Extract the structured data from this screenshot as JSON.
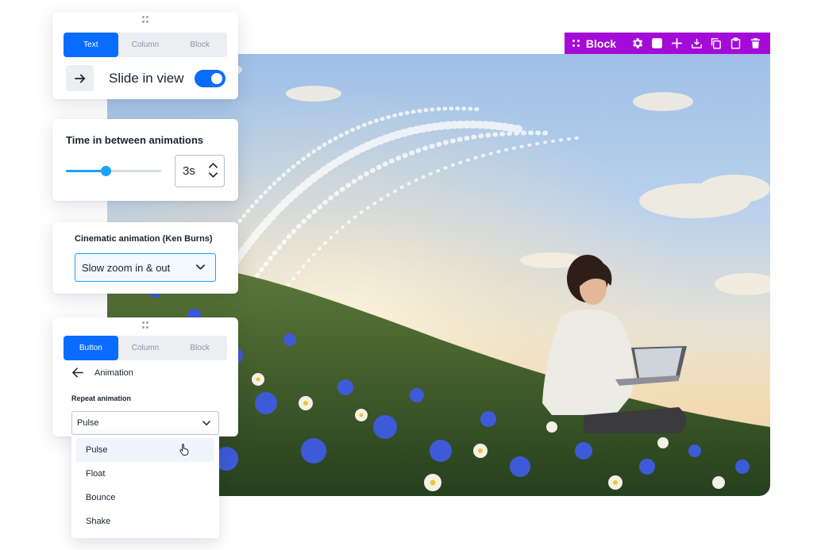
{
  "toolbar": {
    "label": "Block",
    "color": "#a40bd6",
    "actions": [
      "settings-icon",
      "color-swatch",
      "add-icon",
      "download-icon",
      "duplicate-icon",
      "paste-icon",
      "delete-icon"
    ]
  },
  "text_panel": {
    "tabs": [
      {
        "label": "Text",
        "active": true
      },
      {
        "label": "Column",
        "active": false
      },
      {
        "label": "Block",
        "active": false
      }
    ],
    "effect_icon": "arrow-right-icon",
    "effect_label": "Slide in view",
    "toggle_on": true
  },
  "timing_panel": {
    "title": "Time in between animations",
    "slider_fraction": 0.42,
    "value": "3s"
  },
  "cinematic_panel": {
    "title": "Cinematic animation (Ken Burns)",
    "selected": "Slow zoom in & out"
  },
  "button_panel": {
    "tabs": [
      {
        "label": "Button",
        "active": true
      },
      {
        "label": "Column",
        "active": false
      },
      {
        "label": "Block",
        "active": false
      }
    ],
    "back_label": "Animation",
    "repeat_label": "Repeat animation",
    "selected": "Pulse",
    "options": [
      "Pulse",
      "Float",
      "Bounce",
      "Shake"
    ],
    "hovered_index": 0
  },
  "colors": {
    "accent": "#0a6cff",
    "slider": "#1aa3ff",
    "toolbar": "#a40bd6"
  }
}
